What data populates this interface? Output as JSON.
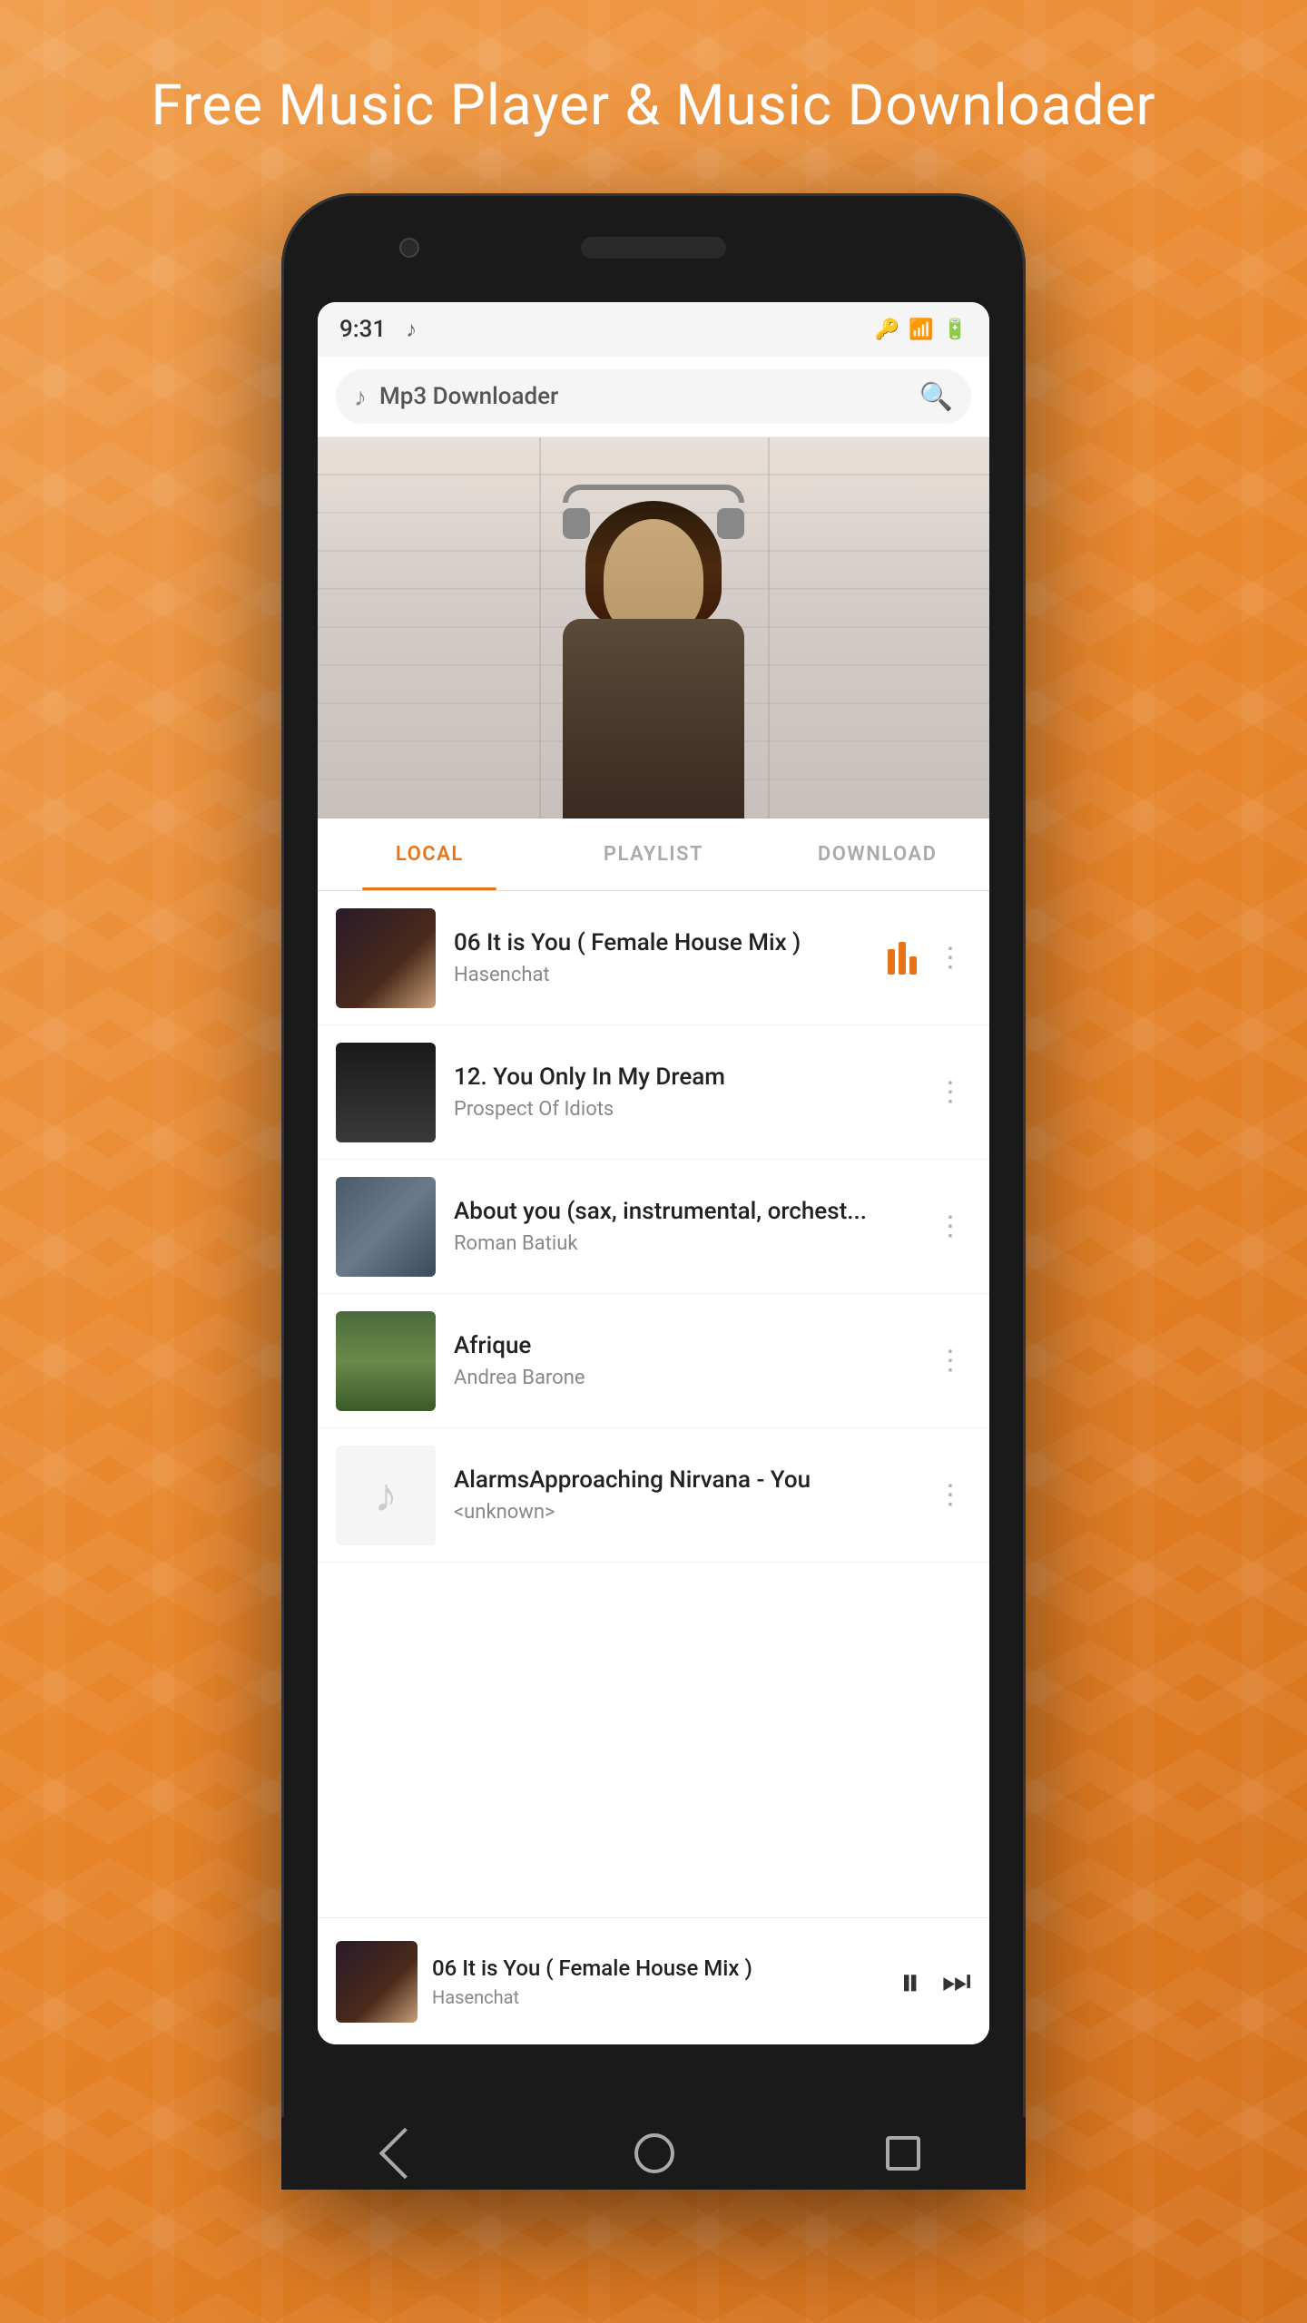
{
  "page": {
    "title": "Free Music Player & Music Downloader"
  },
  "status_bar": {
    "time": "9:31",
    "music_note": "♪"
  },
  "app_header": {
    "app_name": "Mp3 Downloader",
    "search_placeholder": "Mp3 Downloader"
  },
  "tabs": [
    {
      "id": "local",
      "label": "LOCAL",
      "active": true
    },
    {
      "id": "playlist",
      "label": "PLAYLIST",
      "active": false
    },
    {
      "id": "download",
      "label": "DOWNLOAD",
      "active": false
    }
  ],
  "songs": [
    {
      "id": 1,
      "title": "06 It is You ( Female House Mix )",
      "artist": "Hasenchat",
      "playing": true,
      "thumb_type": "art1"
    },
    {
      "id": 2,
      "title": "12. You Only In My Dream",
      "artist": "Prospect Of Idiots",
      "playing": false,
      "thumb_type": "art2"
    },
    {
      "id": 3,
      "title": "About you (sax, instrumental, orchest...",
      "artist": "Roman Batiuk",
      "playing": false,
      "thumb_type": "art3"
    },
    {
      "id": 4,
      "title": "Afrique",
      "artist": "Andrea Barone",
      "playing": false,
      "thumb_type": "art4"
    },
    {
      "id": 5,
      "title": "AlarmsApproaching Nirvana - You",
      "artist": "<unknown>",
      "playing": false,
      "thumb_type": "music_note"
    }
  ],
  "now_playing": {
    "title": "06 It is You ( Female House Mix )",
    "artist": "Hasenchat"
  },
  "colors": {
    "accent": "#e8741a",
    "text_primary": "#222222",
    "text_secondary": "#888888",
    "active_tab": "#e8741a",
    "inactive_tab": "#aaaaaa"
  }
}
